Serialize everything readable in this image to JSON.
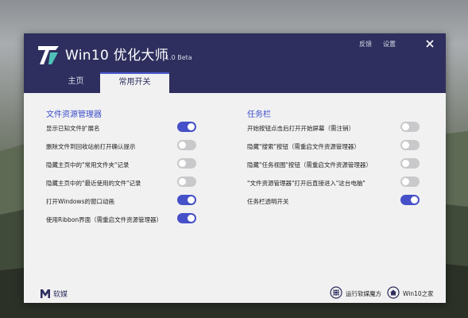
{
  "app": {
    "title": "Win10 优化大师",
    "version": "1.0 Beta"
  },
  "titlebar": {
    "feedback": "反馈",
    "settings": "设置"
  },
  "tabs": [
    {
      "label": "主页",
      "active": false
    },
    {
      "label": "常用开关",
      "active": true
    }
  ],
  "left_section": {
    "title": "文件资源管理器",
    "options": [
      {
        "label": "显示已知文件扩展名",
        "on": true
      },
      {
        "label": "删除文件到回收站前打开确认提示",
        "on": false
      },
      {
        "label": "隐藏主页中的\"常用文件夹\"记录",
        "on": false
      },
      {
        "label": "隐藏主页中的\"最近使用的文件\"记录",
        "on": false
      },
      {
        "label": "打开Windows的窗口动画",
        "on": true
      },
      {
        "label": "使用Ribbon界面（需重启文件资源管理器）",
        "on": true
      }
    ]
  },
  "right_section": {
    "title": "任务栏",
    "options": [
      {
        "label": "开始按钮点击后打开开始屏幕（需注销）",
        "on": false
      },
      {
        "label": "隐藏\"搜索\"按钮（需重启文件资源管理器）",
        "on": false
      },
      {
        "label": "隐藏\"任务视图\"按钮（需重启文件资源管理器）",
        "on": false
      },
      {
        "label": "\"文件资源管理器\"打开后直接进入\"这台电脑\"",
        "on": false
      },
      {
        "label": "任务栏透明开关",
        "on": true
      }
    ]
  },
  "footer": {
    "brand": "软媒",
    "link_magic_cube": "运行软媒魔方",
    "link_win10": "Win10之家"
  },
  "colors": {
    "titlebar": "#2e2f5e",
    "accent": "#4650c8",
    "toggle_off": "#c9c9cc"
  }
}
